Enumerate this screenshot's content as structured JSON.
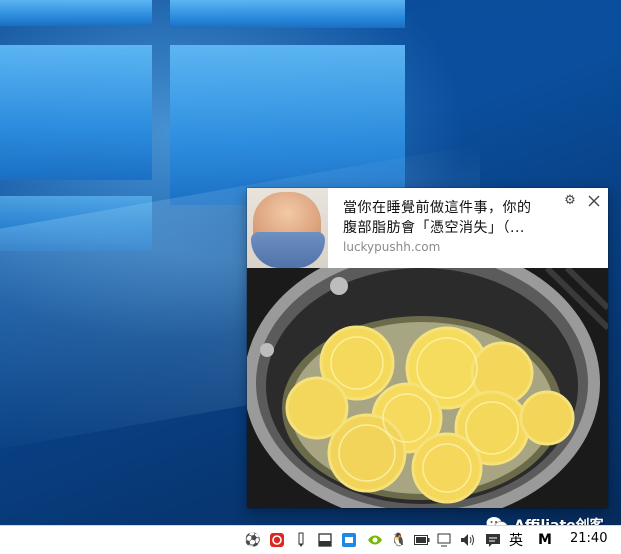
{
  "notification": {
    "title": "當你在睡覺前做這件事，你的腹部脂肪會「憑空消失」（...",
    "source": "luckypushh.com",
    "settings_icon": "gear-icon",
    "close_icon": "close-icon"
  },
  "taskbar": {
    "tray_icons": [
      "soccer-ball-icon",
      "netease-music-icon",
      "pen-icon",
      "window-icon",
      "camera-icon",
      "nvidia-icon",
      "qq-penguin-icon",
      "battery-icon",
      "network-icon",
      "volume-icon",
      "action-center-icon"
    ],
    "ime_label": "英",
    "m_label": "M",
    "clock": "21:40"
  },
  "watermark": {
    "text": "Affiliate创客",
    "icon": "wechat-icon"
  },
  "colors": {
    "accent": "#0a4f9e",
    "taskbar_bg": "#ffffff"
  }
}
